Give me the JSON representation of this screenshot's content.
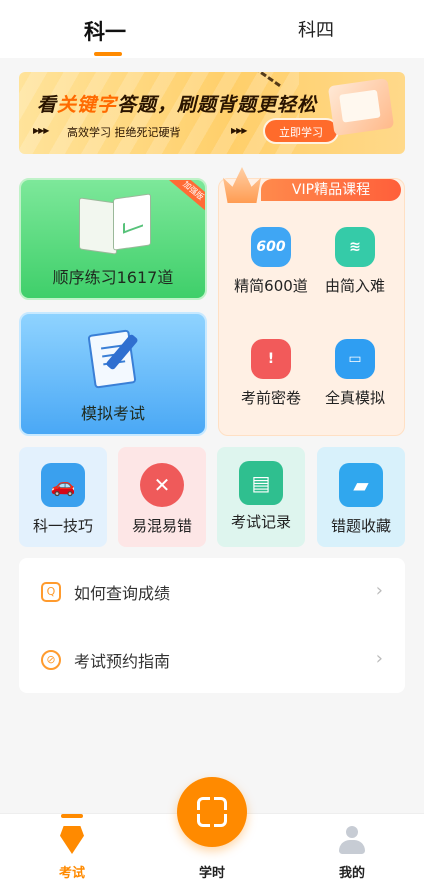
{
  "tabs": [
    {
      "label": "科一"
    },
    {
      "label": "科四"
    }
  ],
  "banner": {
    "title_pre": "看",
    "title_hl": "关键字",
    "title_post": "答题，刷题背题更轻松",
    "subtitle": "高效学习 拒绝死记硬背",
    "button": "立即学习",
    "arrows": "▶▶▶"
  },
  "cards": {
    "sequence": {
      "label": "顺序练习1617道",
      "badge": "加强版"
    },
    "mock": {
      "label": "模拟考试"
    }
  },
  "vip": {
    "header": "VIP精品课程",
    "items": [
      {
        "label": "精简600道",
        "icon_text": "600"
      },
      {
        "label": "由简入难",
        "icon_text": "≋"
      },
      {
        "label": "考前密卷",
        "icon_text": "!"
      },
      {
        "label": "全真模拟",
        "icon_text": "▭"
      }
    ]
  },
  "tools": [
    {
      "label": "科一技巧",
      "icon": "car-icon",
      "glyph": "🚗"
    },
    {
      "label": "易混易错",
      "icon": "x-circle-icon",
      "glyph": "✕"
    },
    {
      "label": "考试记录",
      "icon": "record-icon",
      "glyph": "▤"
    },
    {
      "label": "错题收藏",
      "icon": "folder-icon",
      "glyph": "▰"
    }
  ],
  "list": [
    {
      "label": "如何查询成绩",
      "icon_glyph": "Q"
    },
    {
      "label": "考试预约指南",
      "icon_glyph": "⊘"
    }
  ],
  "bottom_nav": [
    {
      "label": "考试"
    },
    {
      "label": "学时"
    },
    {
      "label": "我的"
    }
  ],
  "colors": {
    "accent": "#ff8a00",
    "green_card": "#3fcf6a",
    "blue_card": "#4aa8f5",
    "vip_bg": "#fff0e4"
  }
}
